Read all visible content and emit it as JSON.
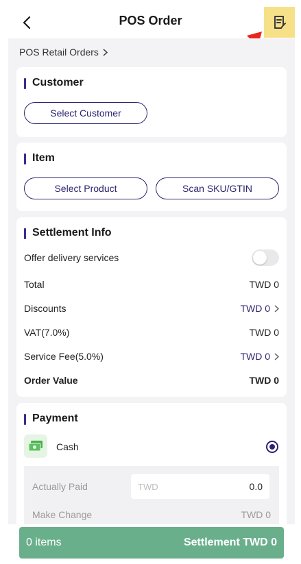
{
  "header": {
    "title": "POS Order",
    "back_icon": "chevron-left-icon",
    "order_icon": "receipt-icon",
    "order_icon_bg": "#f6e189",
    "annotation_arrow_color": "#e8261c"
  },
  "breadcrumb": {
    "label": "POS Retail Orders"
  },
  "customer": {
    "title": "Customer",
    "select_label": "Select Customer"
  },
  "item": {
    "title": "Item",
    "select_product_label": "Select Product",
    "scan_label": "Scan SKU/GTIN"
  },
  "settlement": {
    "title": "Settlement Info",
    "delivery_label": "Offer delivery services",
    "delivery_enabled": false,
    "rows": [
      {
        "label": "Total",
        "value": "TWD 0"
      },
      {
        "label": "Discounts",
        "value": "TWD 0"
      },
      {
        "label": "VAT(7.0%)",
        "value": "TWD 0"
      },
      {
        "label": "Service Fee(5.0%)",
        "value": "TWD 0"
      },
      {
        "label": "Order Value",
        "value": "TWD 0"
      }
    ]
  },
  "payment": {
    "title": "Payment",
    "method": "Cash",
    "method_selected": true,
    "actually_paid_label": "Actually Paid",
    "actually_paid_placeholder": "TWD",
    "actually_paid_value": "0.0",
    "make_change_label": "Make Change",
    "make_change_value": "TWD 0"
  },
  "footer": {
    "items_label": "0 items",
    "settlement_label": "Settlement TWD 0",
    "color": "#6aaf8c"
  },
  "colors": {
    "accent": "#2c2470",
    "background": "#f3f3f5"
  }
}
